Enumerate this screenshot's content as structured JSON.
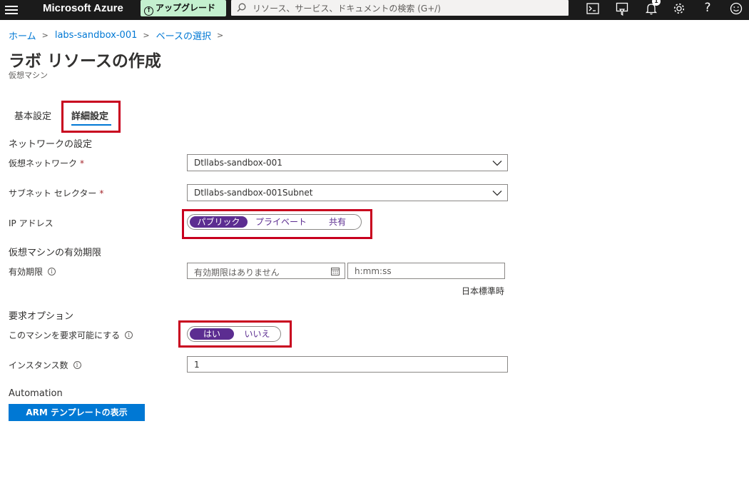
{
  "topbar": {
    "brand": "Microsoft Azure",
    "upgrade_label": "アップグレード",
    "search_placeholder": "リソース、サービス、ドキュメントの検索 (G+/)",
    "notification_count": "1",
    "help_glyph": "?"
  },
  "breadcrumb": {
    "items": [
      "ホーム",
      "labs-sandbox-001",
      "ベースの選択"
    ]
  },
  "page": {
    "title": "ラボ リソースの作成",
    "subtitle": "仮想マシン"
  },
  "tabs": [
    {
      "label": "基本設定",
      "active": false
    },
    {
      "label": "詳細設定",
      "active": true
    }
  ],
  "network": {
    "section_title": "ネットワークの設定",
    "vnet_label": "仮想ネットワーク",
    "vnet_value": "Dtllabs-sandbox-001",
    "subnet_label": "サブネット セレクター",
    "subnet_value": "Dtllabs-sandbox-001Subnet",
    "required_mark": "*",
    "ip_label": "IP アドレス",
    "ip_options": [
      "パブリック",
      "プライベート",
      "共有"
    ],
    "ip_selected": "パブリック"
  },
  "expiration": {
    "section_title": "仮想マシンの有効期限",
    "label": "有効期限",
    "date_placeholder": "有効期限はありません",
    "time_placeholder": "h:mm:ss",
    "timezone": "日本標準時"
  },
  "claim": {
    "section_title": "要求オプション",
    "claimable_label": "このマシンを要求可能にする",
    "options": [
      "はい",
      "いいえ"
    ],
    "selected": "はい",
    "instance_label": "インスタンス数",
    "instance_value": "1"
  },
  "automation": {
    "section_title": "Automation",
    "arm_button": "ARM テンプレートの表示"
  },
  "icons": {
    "info_glyph": "i"
  },
  "colors": {
    "topbar": "#1b1b1b",
    "accent": "#0078d4",
    "toggle_selected": "#5c2d91",
    "highlight": "#c8001e",
    "upgrade": "#c4f0cf"
  }
}
